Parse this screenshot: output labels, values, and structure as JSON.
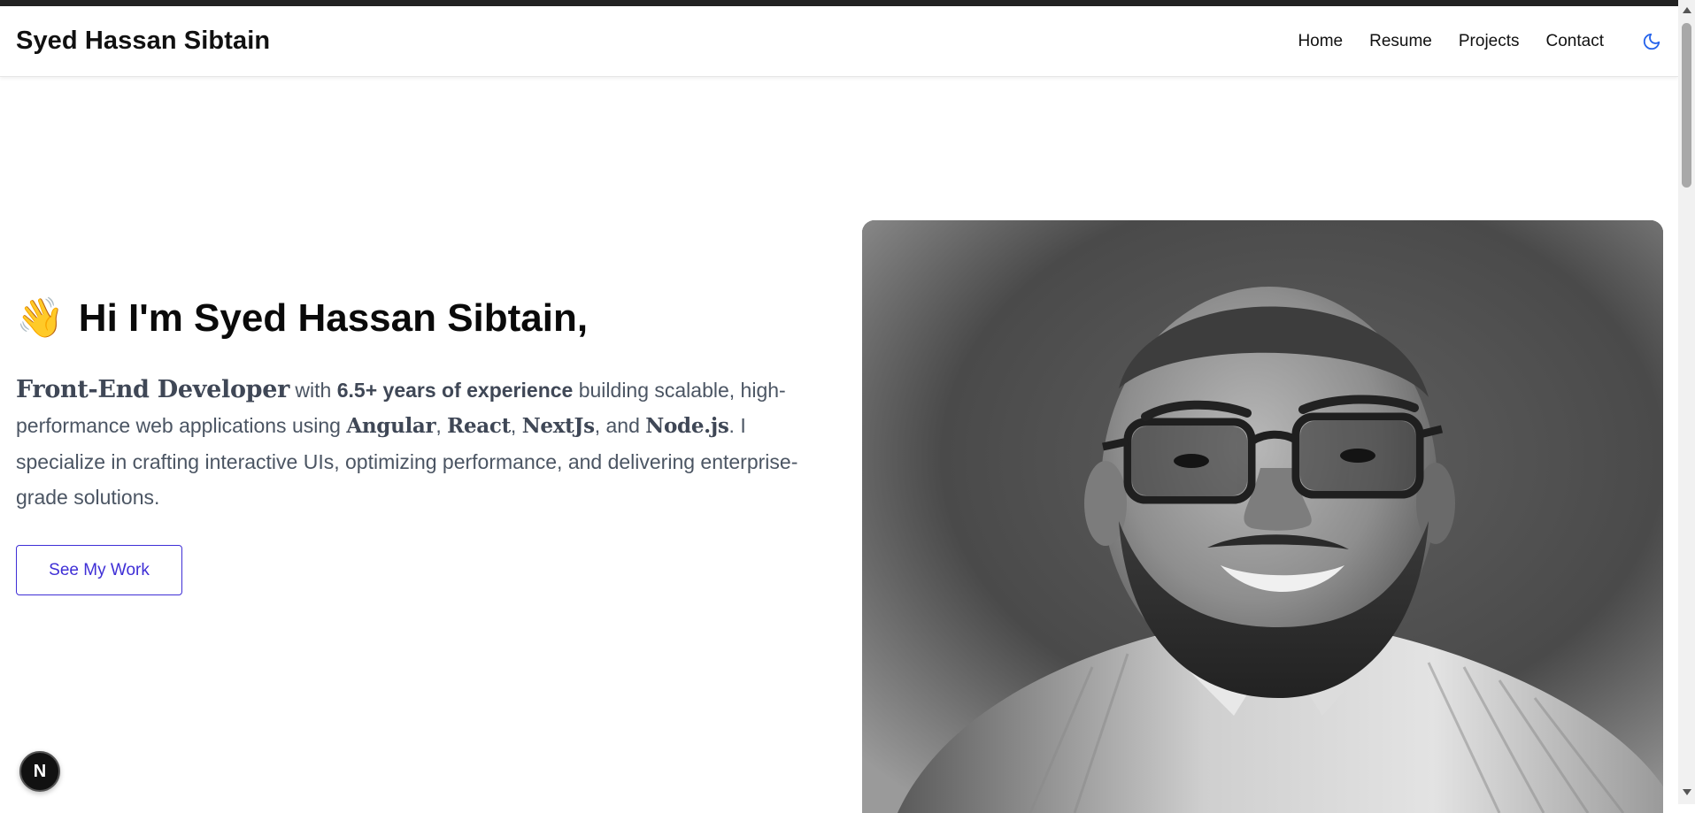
{
  "header": {
    "brand": "Syed Hassan Sibtain",
    "nav": [
      {
        "label": "Home"
      },
      {
        "label": "Resume"
      },
      {
        "label": "Projects"
      },
      {
        "label": "Contact"
      }
    ],
    "theme_toggle_icon": "moon-icon",
    "accent_color": "#2563eb"
  },
  "hero": {
    "wave_emoji": "👋",
    "greeting": "Hi I'm Syed Hassan Sibtain,",
    "intro": {
      "role": "Front-End Developer",
      "t1": " with ",
      "experience": "6.5+ years of experience",
      "t2": " building scalable, high-performance web applications using ",
      "tech1": "Angular",
      "sep1": ", ",
      "tech2": "React",
      "sep2": ", ",
      "tech3": "NextJs",
      "sep3": ", and ",
      "tech4": "Node.js",
      "t3": ". I specialize in crafting interactive UIs, optimizing performance, and delivering enterprise-grade solutions."
    },
    "cta_label": "See My Work",
    "cta_color": "#3f2fd6"
  },
  "photo": {
    "icon": "profile-photo",
    "style": "black-and-white portrait"
  },
  "dev_badge": {
    "label": "N",
    "icon": "nextjs-icon"
  }
}
